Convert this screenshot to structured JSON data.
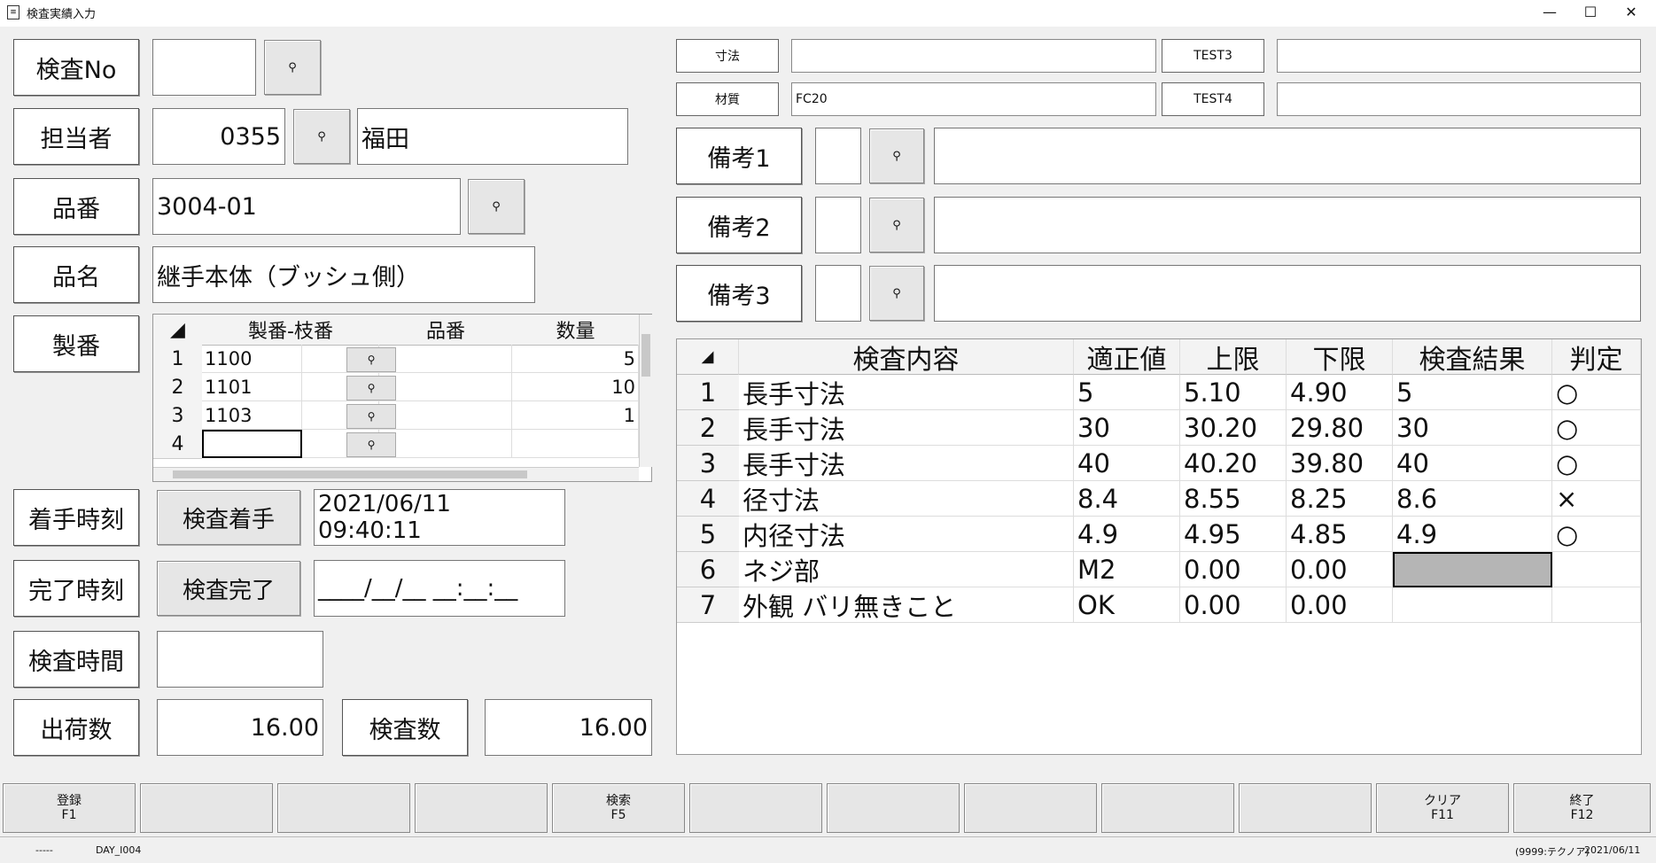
{
  "window": {
    "title": "検査実績入力",
    "minimize": "—",
    "maximize": "☐",
    "close": "✕"
  },
  "left": {
    "inspection_no": {
      "label": "検査No",
      "value": ""
    },
    "person": {
      "label": "担当者",
      "code": "0355",
      "name": "福田"
    },
    "part_no": {
      "label": "品番",
      "value": "3004-01"
    },
    "part_name": {
      "label": "品名",
      "value": "継手本体（ブッシュ側）"
    },
    "mfg_no": {
      "label": "製番"
    },
    "start_time": {
      "label": "着手時刻",
      "button": "検査着手",
      "value": "2021/06/11 09:40:11"
    },
    "end_time": {
      "label": "完了時刻",
      "button": "検査完了",
      "value": "____/__/__ __:__:__"
    },
    "inspect_time": {
      "label": "検査時間",
      "value": ""
    },
    "ship_qty": {
      "label": "出荷数",
      "value": "16.00"
    },
    "inspect_qty": {
      "label": "検査数",
      "value": "16.00"
    }
  },
  "mfg_grid": {
    "headers": [
      "製番-枝番",
      "品番",
      "数量"
    ],
    "rows": [
      {
        "n": "1",
        "mfg": "1100",
        "part": "",
        "qty": "5"
      },
      {
        "n": "2",
        "mfg": "1101",
        "part": "",
        "qty": "10"
      },
      {
        "n": "3",
        "mfg": "1103",
        "part": "",
        "qty": "1"
      },
      {
        "n": "4",
        "mfg": "",
        "part": "",
        "qty": ""
      }
    ]
  },
  "right": {
    "dimension_label": "寸法",
    "dimension_value": "",
    "test3_label": "TEST3",
    "test3_value": "",
    "material_label": "材質",
    "material_value": "FC20",
    "test4_label": "TEST4",
    "test4_value": "",
    "remark1": {
      "label": "備考1",
      "code": "",
      "text": ""
    },
    "remark2": {
      "label": "備考2",
      "code": "",
      "text": ""
    },
    "remark3": {
      "label": "備考3",
      "code": "",
      "text": ""
    }
  },
  "inspect_grid": {
    "headers": [
      "検査内容",
      "適正値",
      "上限",
      "下限",
      "検査結果",
      "判定"
    ],
    "rows": [
      {
        "n": "1",
        "item": "長手寸法",
        "proper": "5",
        "upper": "5.10",
        "lower": "4.90",
        "result": "5",
        "judge": "○"
      },
      {
        "n": "2",
        "item": "長手寸法",
        "proper": "30",
        "upper": "30.20",
        "lower": "29.80",
        "result": "30",
        "judge": "○"
      },
      {
        "n": "3",
        "item": "長手寸法",
        "proper": "40",
        "upper": "40.20",
        "lower": "39.80",
        "result": "40",
        "judge": "○"
      },
      {
        "n": "4",
        "item": "径寸法",
        "proper": "8.4",
        "upper": "8.55",
        "lower": "8.25",
        "result": "8.6",
        "judge": "×"
      },
      {
        "n": "5",
        "item": "内径寸法",
        "proper": "4.9",
        "upper": "4.95",
        "lower": "4.85",
        "result": "4.9",
        "judge": "○"
      },
      {
        "n": "6",
        "item": "ネジ部",
        "proper": "M2",
        "upper": "0.00",
        "lower": "0.00",
        "result": "",
        "judge": ""
      },
      {
        "n": "7",
        "item": "外観 バリ無きこと",
        "proper": "OK",
        "upper": "0.00",
        "lower": "0.00",
        "result": "",
        "judge": ""
      }
    ]
  },
  "fkeys": [
    {
      "label": "登録",
      "key": "F1"
    },
    {
      "label": "",
      "key": ""
    },
    {
      "label": "",
      "key": ""
    },
    {
      "label": "",
      "key": ""
    },
    {
      "label": "検索",
      "key": "F5"
    },
    {
      "label": "",
      "key": ""
    },
    {
      "label": "",
      "key": ""
    },
    {
      "label": "",
      "key": ""
    },
    {
      "label": "",
      "key": ""
    },
    {
      "label": "",
      "key": ""
    },
    {
      "label": "クリア",
      "key": "F11"
    },
    {
      "label": "終了",
      "key": "F12"
    }
  ],
  "status": {
    "left": "-----",
    "screen_id": "DAY_I004",
    "user": "(9999:テクノア)",
    "date": "2021/06/11"
  },
  "icons": {
    "search": "⚲"
  }
}
